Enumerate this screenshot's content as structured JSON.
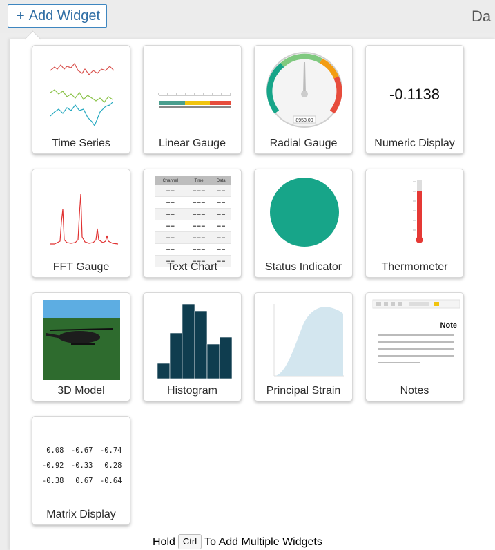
{
  "toolbar": {
    "add_widget_label": "Add Widget",
    "add_icon": "+",
    "title_partial": "Da"
  },
  "tiles": [
    {
      "label": "Time Series",
      "icon": "time-series-icon"
    },
    {
      "label": "Linear Gauge",
      "icon": "linear-gauge-icon"
    },
    {
      "label": "Radial Gauge",
      "icon": "radial-gauge-icon"
    },
    {
      "label": "Numeric Display",
      "icon": "numeric-display-icon"
    },
    {
      "label": "FFT Gauge",
      "icon": "fft-gauge-icon"
    },
    {
      "label": "Text Chart",
      "icon": "text-chart-icon"
    },
    {
      "label": "Status Indicator",
      "icon": "status-indicator-icon"
    },
    {
      "label": "Thermometer",
      "icon": "thermometer-icon"
    },
    {
      "label": "3D Model",
      "icon": "3d-model-icon"
    },
    {
      "label": "Histogram",
      "icon": "histogram-icon"
    },
    {
      "label": "Principal Strain",
      "icon": "principal-strain-icon"
    },
    {
      "label": "Notes",
      "icon": "notes-icon"
    },
    {
      "label": "Matrix Display",
      "icon": "matrix-display-icon"
    }
  ],
  "numeric_display": {
    "value": "-0.1138"
  },
  "radial_gauge": {
    "readout": "8953.00"
  },
  "text_chart": {
    "headers": [
      "Channel",
      "Time",
      "Data"
    ]
  },
  "matrix_display": {
    "rows": [
      [
        "0.08",
        "-0.67",
        "-0.74"
      ],
      [
        "-0.92",
        "-0.33",
        "0.28"
      ],
      [
        "-0.38",
        "0.67",
        "-0.64"
      ]
    ]
  },
  "notes": {
    "heading": "Note"
  },
  "status_indicator": {
    "color": "#17a589"
  },
  "hint": {
    "prefix": "Hold",
    "key": "Ctrl",
    "suffix": "To Add Multiple Widgets"
  }
}
